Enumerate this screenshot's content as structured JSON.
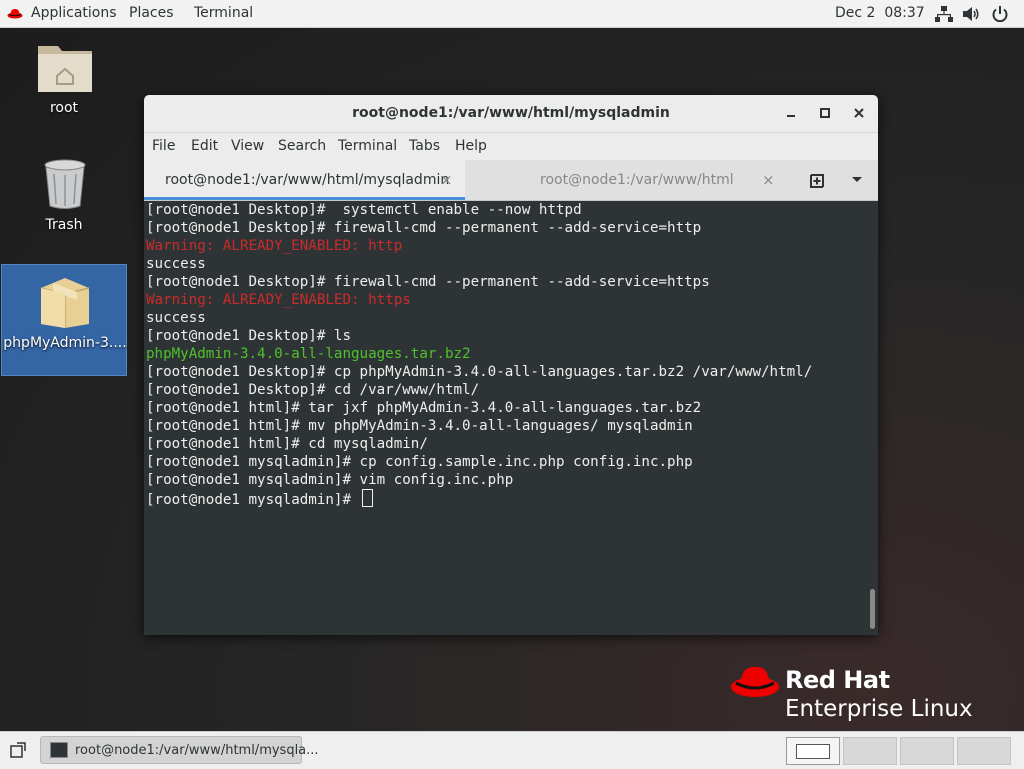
{
  "topbar": {
    "applications": "Applications",
    "places": "Places",
    "terminal": "Terminal",
    "clock": "Dec 2  08:37",
    "icons": [
      "network-icon",
      "volume-icon",
      "power-icon"
    ]
  },
  "desktop": {
    "icons": [
      {
        "label": "root",
        "icon": "home-folder-icon"
      },
      {
        "label": "Trash",
        "icon": "trash-icon"
      },
      {
        "label": "phpMyAdmin-3....",
        "icon": "package-icon"
      }
    ]
  },
  "window": {
    "title": "root@node1:/var/www/html/mysqladmin",
    "controls": {
      "minimize": "_",
      "maximize": "□",
      "close": "×"
    },
    "menu": [
      "File",
      "Edit",
      "View",
      "Search",
      "Terminal",
      "Tabs",
      "Help"
    ],
    "tabs": [
      {
        "label": "root@node1:/var/www/html/mysqladmin",
        "active": true
      },
      {
        "label": "root@node1:/var/www/html",
        "active": false
      }
    ],
    "tab_close": "×",
    "terminal_lines": [
      {
        "text": "[root@node1 Desktop]#  systemctl enable --now httpd",
        "kind": "normal"
      },
      {
        "text": "[root@node1 Desktop]# firewall-cmd --permanent --add-service=http",
        "kind": "normal"
      },
      {
        "text": "Warning: ALREADY_ENABLED: http",
        "kind": "warn"
      },
      {
        "text": "success",
        "kind": "normal"
      },
      {
        "text": "[root@node1 Desktop]# firewall-cmd --permanent --add-service=https",
        "kind": "normal"
      },
      {
        "text": "Warning: ALREADY_ENABLED: https",
        "kind": "warn"
      },
      {
        "text": "success",
        "kind": "normal"
      },
      {
        "text": "[root@node1 Desktop]# ls",
        "kind": "normal"
      },
      {
        "text": "phpMyAdmin-3.4.0-all-languages.tar.bz2",
        "kind": "file"
      },
      {
        "text": "[root@node1 Desktop]# cp phpMyAdmin-3.4.0-all-languages.tar.bz2 /var/www/html/",
        "kind": "normal"
      },
      {
        "text": "[root@node1 Desktop]# cd /var/www/html/",
        "kind": "normal"
      },
      {
        "text": "[root@node1 html]# tar jxf phpMyAdmin-3.4.0-all-languages.tar.bz2",
        "kind": "normal"
      },
      {
        "text": "[root@node1 html]# mv phpMyAdmin-3.4.0-all-languages/ mysqladmin",
        "kind": "normal"
      },
      {
        "text": "[root@node1 html]# cd mysqladmin/",
        "kind": "normal"
      },
      {
        "text": "[root@node1 mysqladmin]# cp config.sample.inc.php config.inc.php",
        "kind": "normal"
      },
      {
        "text": "[root@node1 mysqladmin]# vim config.inc.php",
        "kind": "normal"
      }
    ],
    "prompt": "[root@node1 mysqladmin]# "
  },
  "branding": {
    "line1": "Red Hat",
    "line2": "Enterprise Linux"
  },
  "taskbar": {
    "window_label": "root@node1:/var/www/html/mysqla...",
    "workspaces": 4
  },
  "colors": {
    "terminal_bg": "#2e3436",
    "terminal_fg": "#eeeeec",
    "warning": "#cc2a2a",
    "filename": "#4ec22a",
    "tab_underline": "#4a90d9",
    "brand_red": "#ee0000"
  }
}
